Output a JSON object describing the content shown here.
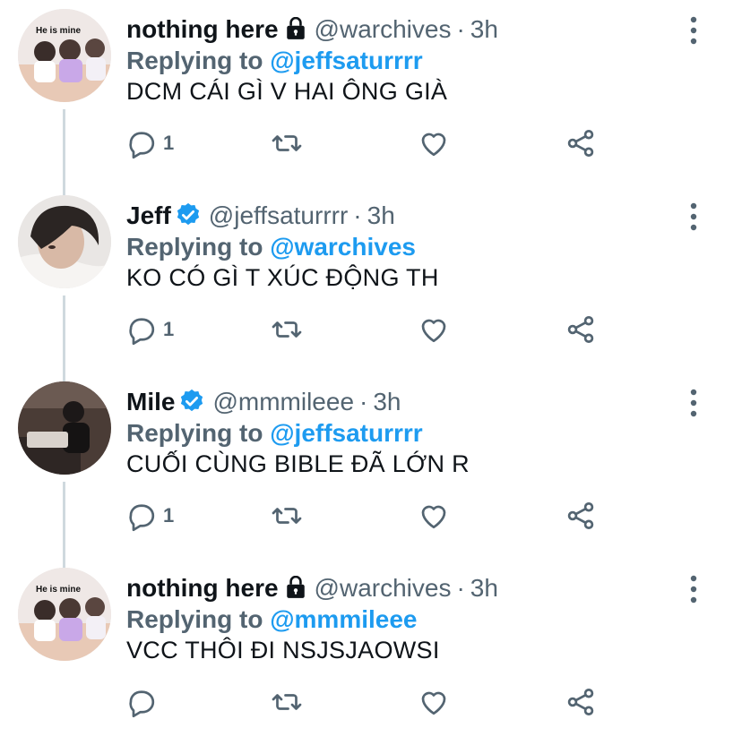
{
  "tweets": [
    {
      "name": "nothing here",
      "badge": "lock",
      "handle": "@warchives",
      "separator": "·",
      "time": "3h",
      "replying_prefix": "Replying to",
      "replying_to": "@jeffsaturrrr",
      "text": "DCM CÁI GÌ V HAI ÔNG GIÀ",
      "reply_count": "1",
      "avatar_caption": "He is mine"
    },
    {
      "name": "Jeff",
      "badge": "verified",
      "handle": "@jeffsaturrrr",
      "separator": "·",
      "time": "3h",
      "replying_prefix": "Replying to",
      "replying_to": "@warchives",
      "text": "KO CÓ GÌ T XÚC ĐỘNG TH",
      "reply_count": "1"
    },
    {
      "name": "Mile",
      "badge": "verified",
      "handle": "@mmmileee",
      "separator": "·",
      "time": "3h",
      "replying_prefix": "Replying to",
      "replying_to": "@jeffsaturrrr",
      "text": "CUỐI CÙNG BIBLE ĐÃ LỚN R",
      "reply_count": "1"
    },
    {
      "name": "nothing here",
      "badge": "lock",
      "handle": "@warchives",
      "separator": "·",
      "time": "3h",
      "replying_prefix": "Replying to",
      "replying_to": "@mmmileee",
      "text": "VCC THÔI ĐI NSJSJAOWSI",
      "reply_count": "",
      "avatar_caption": "He is mine"
    }
  ],
  "icons": {
    "more": "more-vertical-icon",
    "reply": "reply-icon",
    "retweet": "retweet-icon",
    "like": "heart-icon",
    "share": "share-icon",
    "lock": "lock-icon",
    "verified": "verified-badge-icon"
  },
  "colors": {
    "text": "#0f1419",
    "secondary": "#536471",
    "accent": "#1d9bf0",
    "thread_line": "#cfd9de"
  }
}
